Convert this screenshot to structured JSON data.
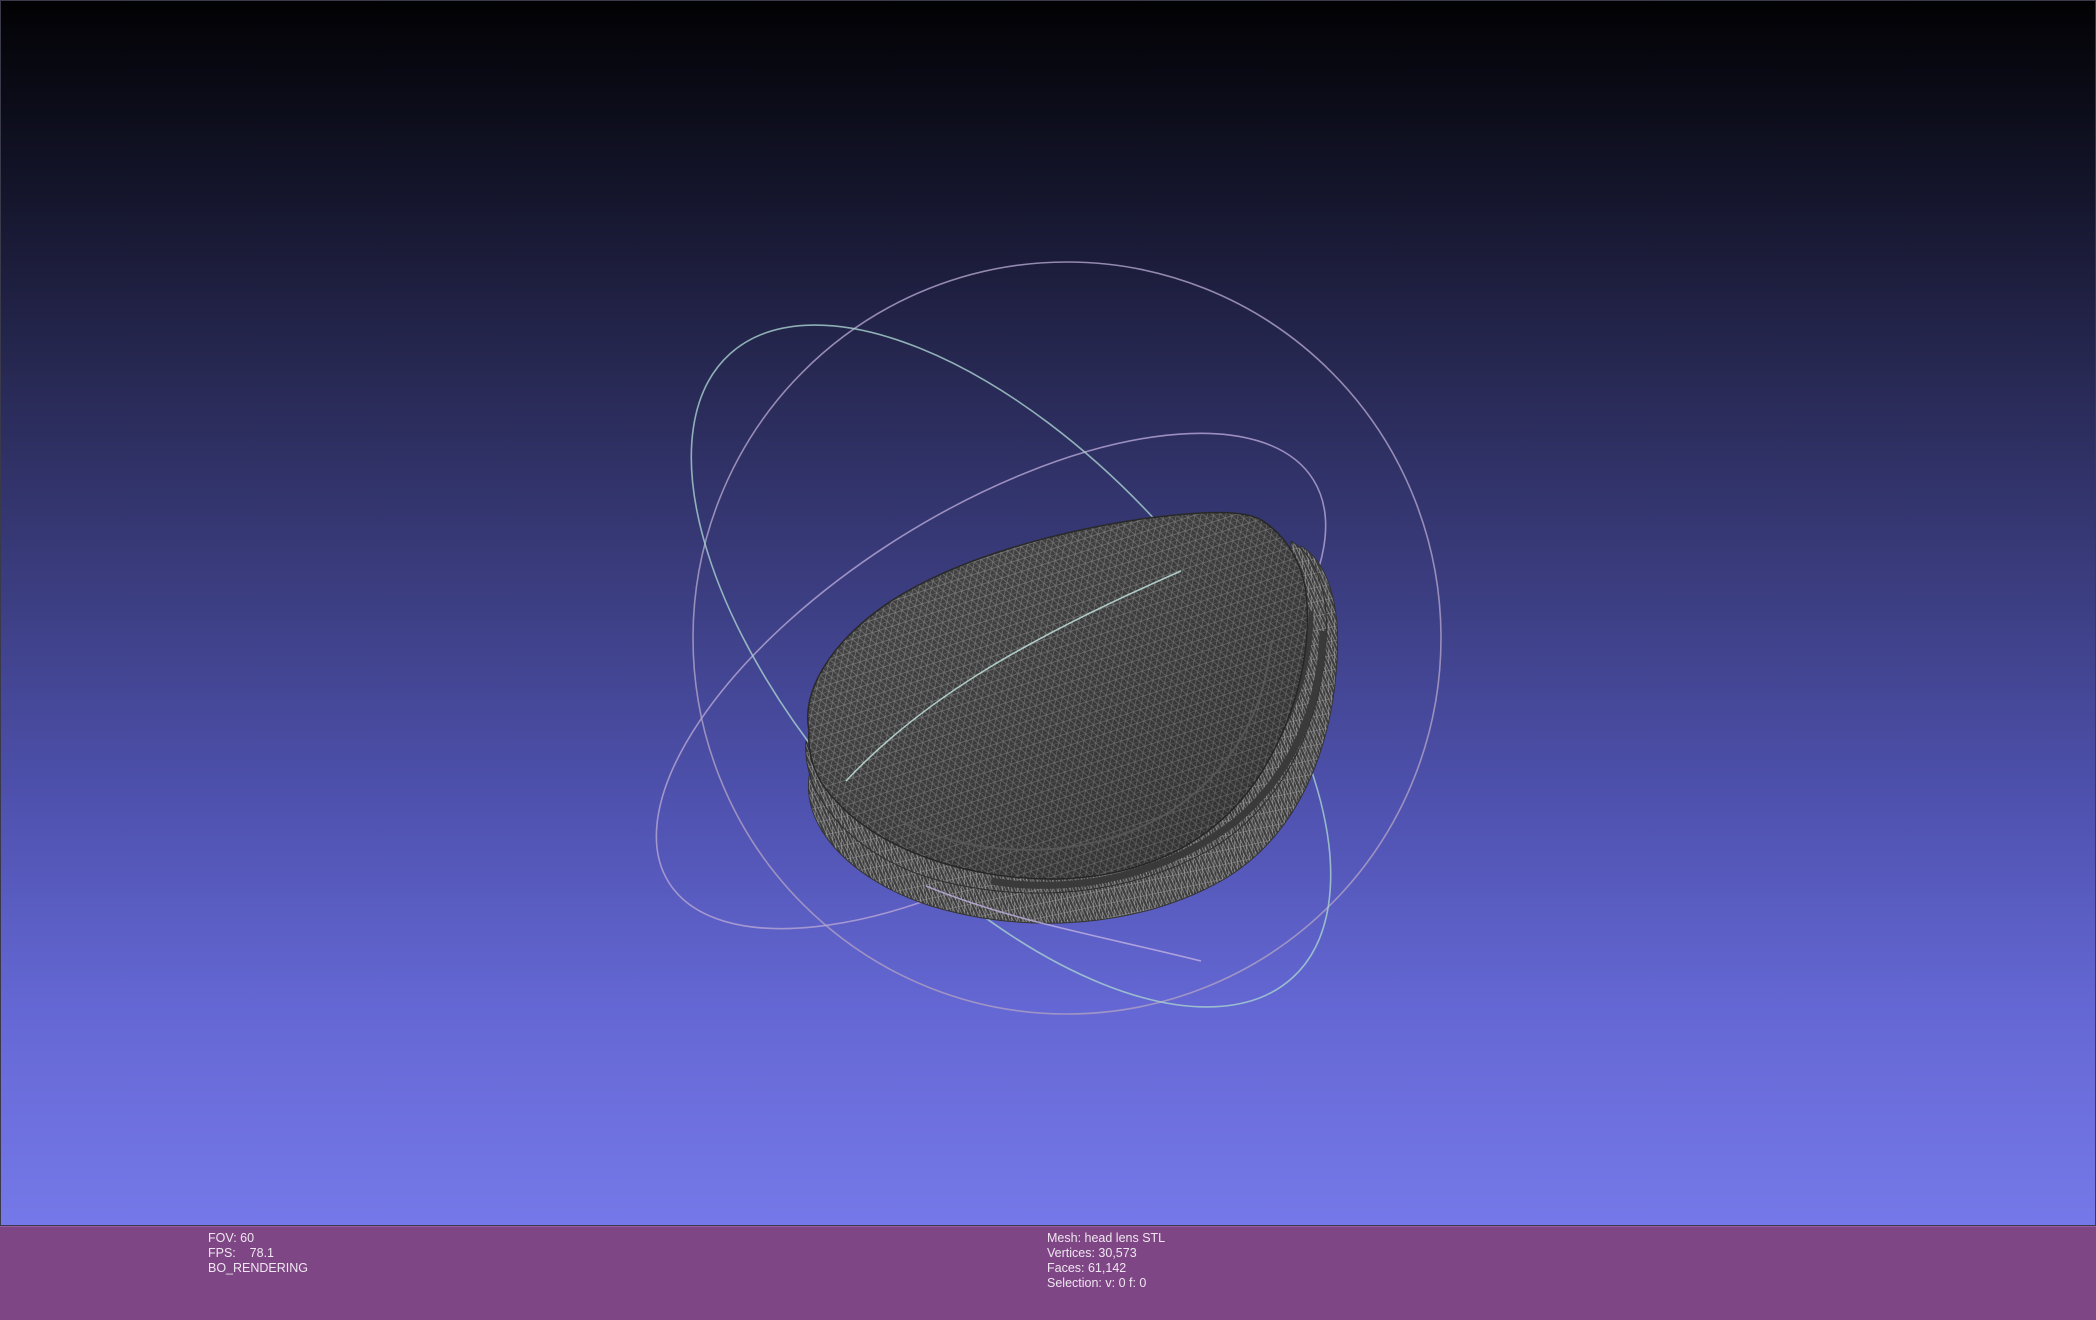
{
  "viewport": {
    "background_top": "#020204",
    "background_bottom": "#7578e8",
    "mesh_color": "#4a4a4a",
    "wire_color": "#8c8c8c",
    "trackball_colors": [
      "#c9a8d8",
      "#a8d8c8",
      "#b8a8e8"
    ]
  },
  "info": {
    "fov": "FOV: 60",
    "fps": "FPS:    78.1",
    "render_mode": "BO_RENDERING",
    "mesh": "Mesh: head lens STL",
    "vertices": "Vertices: 30,573",
    "faces": "Faces: 61,142",
    "selection": "Selection: v: 0 f: 0"
  },
  "colors": {
    "infobar_bg": "#7e4684",
    "infobar_text": "#f0e6f2"
  }
}
